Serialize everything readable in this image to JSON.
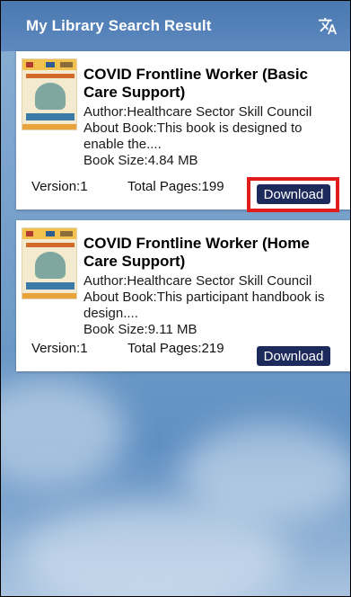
{
  "appbar": {
    "title": "My Library Search Result",
    "translate_icon": "translate-icon"
  },
  "books": [
    {
      "title": "COVID Frontline Worker (Basic Care Support)",
      "author": "Author:Healthcare Sector Skill Council",
      "about": "About Book:This book is designed to enable the....",
      "size": "Book Size:4.84 MB",
      "version": "Version:1",
      "pages": "Total Pages:199",
      "download_label": "Download"
    },
    {
      "title": "COVID Frontline Worker (Home Care Support)",
      "author": "Author:Healthcare Sector Skill Council",
      "about": "About Book:This participant handbook is design....",
      "size": "Book Size:9.11 MB",
      "version": "Version:1",
      "pages": "Total Pages:219",
      "download_label": "Download"
    }
  ],
  "colors": {
    "appbar": "#5d89bf",
    "download_button": "#1c2a5c",
    "highlight": "#e21b1b"
  }
}
